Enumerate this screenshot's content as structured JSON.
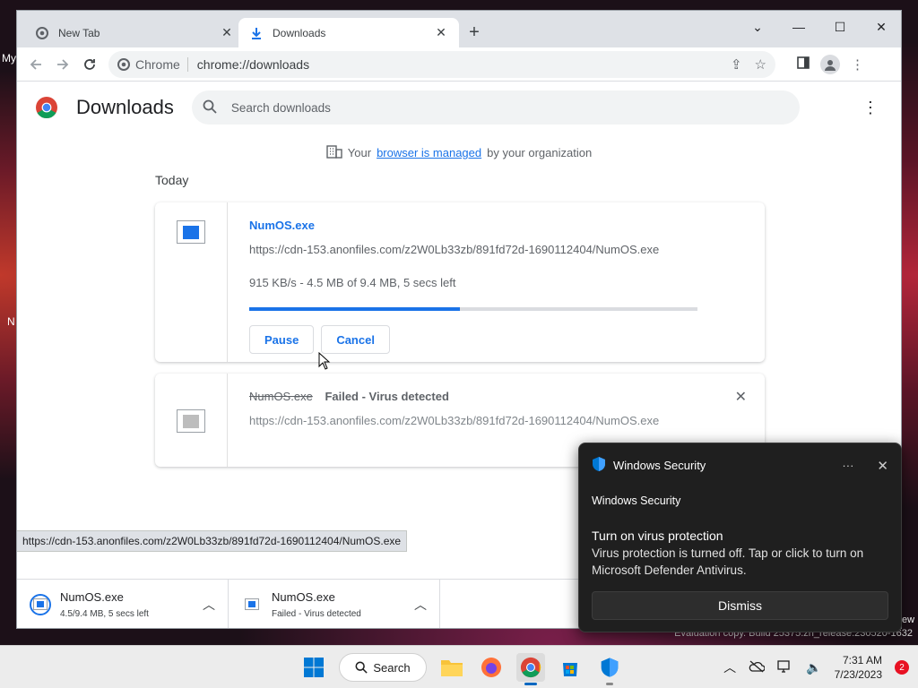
{
  "desktop": {
    "left_text_1": "My",
    "left_text_2": "N",
    "right_text": "ew",
    "eval_line": "Evaluation copy. Build 25375.zn_release.230520-1632"
  },
  "browser": {
    "tabs": [
      {
        "label": "New Tab",
        "icon": "chrome-icon"
      },
      {
        "label": "Downloads",
        "icon": "download-icon"
      }
    ],
    "new_tab_label": "+",
    "window_controls": {
      "list": "⌄",
      "minimize": "—",
      "maximize": "☐",
      "close": "✕"
    },
    "omnibox": {
      "chip": "Chrome",
      "url": "chrome://downloads"
    }
  },
  "downloads": {
    "title": "Downloads",
    "search_placeholder": "Search downloads",
    "managed": {
      "prefix": "Your",
      "link": "browser is managed",
      "suffix": "by your organization"
    },
    "section": "Today",
    "items": [
      {
        "name": "NumOS.exe",
        "url": "https://cdn-153.anonfiles.com/z2W0Lb33zb/891fd72d-1690112404/NumOS.exe",
        "status": "915 KB/s - 4.5 MB of 9.4 MB, 5 secs left",
        "progress": 0.47,
        "buttons": [
          "Pause",
          "Cancel"
        ]
      },
      {
        "name": "NumOS.exe",
        "failed_text": "Failed - Virus detected",
        "url": "https://cdn-153.anonfiles.com/z2W0Lb33zb/891fd72d-1690112404/NumOS.exe"
      }
    ],
    "hover_url": "https://cdn-153.anonfiles.com/z2W0Lb33zb/891fd72d-1690112404/NumOS.exe"
  },
  "shelf": [
    {
      "name": "NumOS.exe",
      "status": "4.5/9.4 MB, 5 secs left"
    },
    {
      "name": "NumOS.exe",
      "status": "Failed - Virus detected"
    }
  ],
  "toast": {
    "app": "Windows Security",
    "subtitle": "Windows Security",
    "title": "Turn on virus protection",
    "message": "Virus protection is turned off. Tap or click to turn on Microsoft Defender Antivirus.",
    "dismiss": "Dismiss",
    "more": "···"
  },
  "taskbar": {
    "search_label": "Search",
    "time": "7:31 AM",
    "date": "7/23/2023",
    "notification_count": "2"
  },
  "colors": {
    "accent": "#1a73e8",
    "toast_bg": "#1f1f1f"
  }
}
